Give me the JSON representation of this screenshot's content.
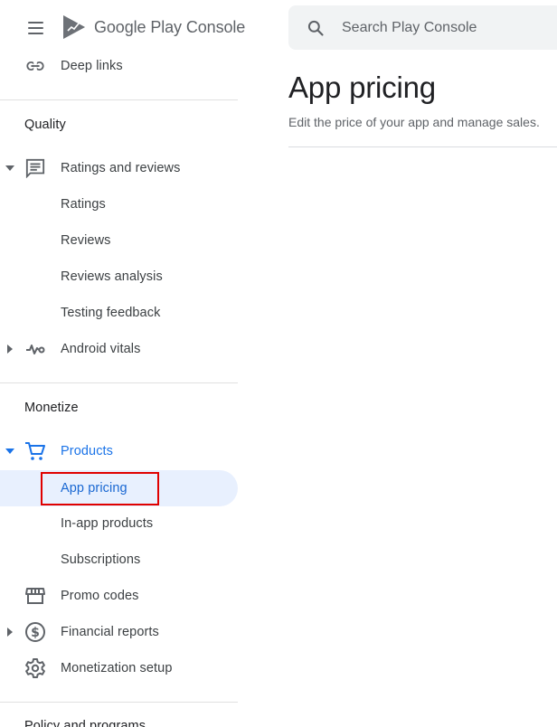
{
  "header": {
    "logo_brand": "Google Play",
    "logo_product": "Console",
    "search_placeholder": "Search Play Console"
  },
  "sidebar": {
    "top_items": [
      {
        "label": "Deep links",
        "icon": "link-icon"
      }
    ],
    "sections": [
      {
        "title": "Quality",
        "items": [
          {
            "label": "Ratings and reviews",
            "icon": "reviews-icon",
            "expanded": true
          },
          {
            "label": "Ratings"
          },
          {
            "label": "Reviews"
          },
          {
            "label": "Reviews analysis"
          },
          {
            "label": "Testing feedback"
          },
          {
            "label": "Android vitals",
            "icon": "vitals-icon",
            "expanded": false
          }
        ]
      },
      {
        "title": "Monetize",
        "items": [
          {
            "label": "Products",
            "icon": "cart-icon",
            "expanded": true
          },
          {
            "label": "App pricing",
            "selected": true
          },
          {
            "label": "In-app products"
          },
          {
            "label": "Subscriptions"
          },
          {
            "label": "Promo codes",
            "icon": "store-icon"
          },
          {
            "label": "Financial reports",
            "icon": "dollar-icon",
            "expanded": false
          },
          {
            "label": "Monetization setup",
            "icon": "gear-icon"
          }
        ]
      },
      {
        "title": "Policy and programs"
      }
    ]
  },
  "main": {
    "title": "App pricing",
    "subtitle": "Edit the price of your app and manage sales."
  },
  "colors": {
    "accent": "#1a73e8",
    "selected_bg": "#e8f0fe",
    "highlight": "#e00000"
  }
}
